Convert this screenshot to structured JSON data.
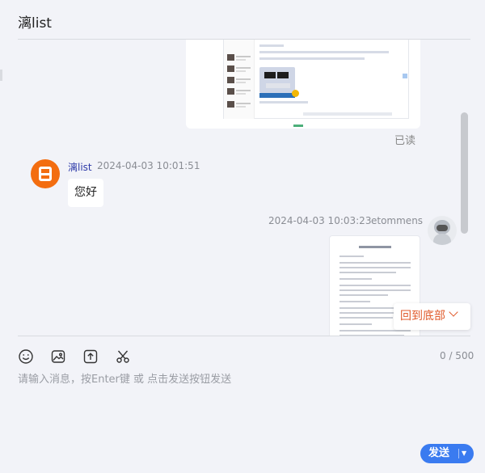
{
  "header": {
    "title": "漓list"
  },
  "messages": {
    "read_status": "已读",
    "incoming": {
      "sender": "漓list",
      "time": "2024-04-03 10:01:51",
      "text": "您好"
    },
    "outgoing": {
      "time": "2024-04-03 10:03:23",
      "sender": "etommens"
    }
  },
  "back_to_bottom": {
    "label": "回到底部"
  },
  "composer": {
    "counter": "0 / 500",
    "placeholder": "请输入消息，按Enter键 或 点击发送按钮发送",
    "send_label": "发送",
    "tools": [
      "emoji-icon",
      "image-icon",
      "upload-file-icon",
      "scissors-icon"
    ]
  },
  "colors": {
    "background": "#f2f3f8",
    "accent": "#3a7bf0",
    "avatar_brand": "#f36d10",
    "back_to_bottom": "#e05a2b"
  }
}
